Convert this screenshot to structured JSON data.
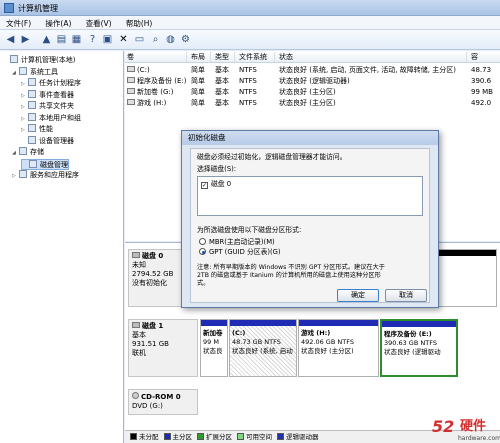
{
  "window": {
    "title": "计算机管理"
  },
  "menu": [
    "文件(F)",
    "操作(A)",
    "查看(V)",
    "帮助(H)"
  ],
  "tree": [
    {
      "label": "计算机管理(本地)",
      "indent": 0,
      "icon": "computer-icon",
      "expander": ""
    },
    {
      "label": "系统工具",
      "indent": 1,
      "icon": "tools-icon",
      "expander": "◢"
    },
    {
      "label": "任务计划程序",
      "indent": 2,
      "icon": "task-scheduler-icon",
      "expander": "▷"
    },
    {
      "label": "事件查看器",
      "indent": 2,
      "icon": "event-viewer-icon",
      "expander": "▷"
    },
    {
      "label": "共享文件夹",
      "indent": 2,
      "icon": "shared-folder-icon",
      "expander": "▷"
    },
    {
      "label": "本地用户和组",
      "indent": 2,
      "icon": "users-icon",
      "expander": "▷"
    },
    {
      "label": "性能",
      "indent": 2,
      "icon": "performance-icon",
      "expander": "▷"
    },
    {
      "label": "设备管理器",
      "indent": 2,
      "icon": "device-manager-icon",
      "expander": ""
    },
    {
      "label": "存储",
      "indent": 1,
      "icon": "storage-icon",
      "expander": "◢"
    },
    {
      "label": "磁盘管理",
      "indent": 2,
      "icon": "disk-management-icon",
      "expander": "",
      "selected": true
    },
    {
      "label": "服务和应用程序",
      "indent": 1,
      "icon": "services-icon",
      "expander": "▷"
    }
  ],
  "volume_table": {
    "headers": [
      "卷",
      "布局",
      "类型",
      "文件系统",
      "状态",
      "容"
    ],
    "rows": [
      [
        "(C:)",
        "简单",
        "基本",
        "NTFS",
        "状态良好 (系统, 启动, 页面文件, 活动, 故障转储, 主分区)",
        "48.73"
      ],
      [
        "程序及备份 (E:)",
        "简单",
        "基本",
        "NTFS",
        "状态良好 (逻辑驱动器)",
        "390.6"
      ],
      [
        "新加卷 (G:)",
        "简单",
        "基本",
        "NTFS",
        "状态良好 (主分区)",
        "99 MB"
      ],
      [
        "游戏 (H:)",
        "简单",
        "基本",
        "NTFS",
        "状态良好 (主分区)",
        "492.0"
      ]
    ]
  },
  "disks": [
    {
      "name": "磁盘 0",
      "line2": "未知",
      "line3": "2794.52 GB",
      "line4": "没有初始化"
    },
    {
      "name": "磁盘 1",
      "line2": "基本",
      "line3": "931.51 GB",
      "line4": "联机"
    },
    {
      "name": "CD-ROM 0",
      "line2": "DVD (G:)",
      "line3": "",
      "line4": ""
    }
  ],
  "disk1_partitions": [
    {
      "title": "新加卷",
      "size": "99 M",
      "status": "状态良",
      "bar": "#1f2bb3",
      "hatched": false,
      "selected": false
    },
    {
      "title": "(C:)",
      "size": "48.73 GB NTFS",
      "status": "状态良好 (系统, 启动",
      "bar": "#1f2bb3",
      "hatched": true,
      "selected": false
    },
    {
      "title": "游戏 (H:)",
      "size": "492.06 GB NTFS",
      "status": "状态良好 (主分区)",
      "bar": "#1f2bb3",
      "hatched": false,
      "selected": false
    },
    {
      "title": "程序及备份 (E:)",
      "size": "390.63 GB NTFS",
      "status": "状态良好 (逻辑驱动",
      "bar": "#1f2bb3",
      "hatched": false,
      "selected": true
    }
  ],
  "legend": [
    {
      "label": "未分配",
      "color": "#000000"
    },
    {
      "label": "主分区",
      "color": "#1f2bb3"
    },
    {
      "label": "扩展分区",
      "color": "#2e9a2e"
    },
    {
      "label": "可用空间",
      "color": "#7fd87f"
    },
    {
      "label": "逻辑驱动器",
      "color": "#2233aa"
    }
  ],
  "dialog": {
    "title": "初始化磁盘",
    "intro": "磁盘必须经过初始化，逻辑磁盘管理器才能访问。",
    "select_label": "选择磁盘(S):",
    "disk_item": "磁盘 0",
    "style_label": "为所选磁盘使用以下磁盘分区形式:",
    "option_mbr": "MBR(主启动记录)(M)",
    "option_gpt": "GPT (GUID 分区表)(G)",
    "note_line1": "注意: 所有早期版本的 Windows 不识别 GPT 分区形式。建议在大于",
    "note_line2": "2TB 的磁盘或基于 Itanium 的计算机所用的磁盘上使用这种分区形",
    "note_line3": "式。",
    "ok": "确定",
    "cancel": "取消"
  },
  "watermark": {
    "brand": "硬件",
    "site": "hardware.com"
  }
}
